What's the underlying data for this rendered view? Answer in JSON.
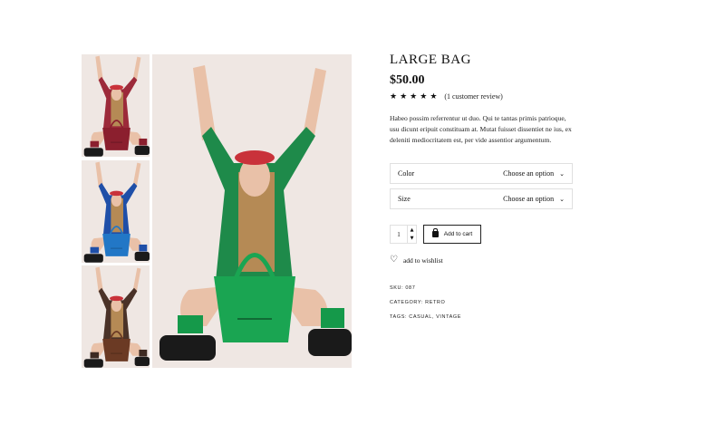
{
  "product": {
    "title": "LARGE BAG",
    "price": "$50.00",
    "rating_stars": 5,
    "review_text": "(1 customer review)",
    "description": "Habeo possim referrentur ut duo. Qui te tantas primis patrioque, usu dicunt eripuit constituam at. Mutat fuisset dissentiet ne ius, ex deleniti mediocritatem est, per vide assentior argumentum."
  },
  "gallery": {
    "thumbnails": [
      {
        "name": "red-outfit",
        "jacket": "#9c2a3a",
        "bag": "#8b1f2e",
        "socks": "#8b1f2e"
      },
      {
        "name": "blue-outfit",
        "jacket": "#1f4fa8",
        "bag": "#2277c6",
        "socks": "#1f4fa8"
      },
      {
        "name": "brown-outfit",
        "jacket": "#4a3228",
        "bag": "#6b3a24",
        "socks": "#3d2a22"
      }
    ],
    "main": {
      "jacket": "#1e8a4a",
      "bag": "#1aa552",
      "socks": "#15994a"
    }
  },
  "variations": [
    {
      "label": "Color",
      "value": "Choose an option"
    },
    {
      "label": "Size",
      "value": "Choose an option"
    }
  ],
  "cart": {
    "quantity": "1",
    "add_label": "Add to cart"
  },
  "wishlist_label": "add to wishlist",
  "meta": {
    "sku_label": "SKU:",
    "sku": "087",
    "category_label": "CATEGORY:",
    "category": "RETRO",
    "tags_label": "TAGS:",
    "tags": "CASUAL, VINTAGE"
  }
}
